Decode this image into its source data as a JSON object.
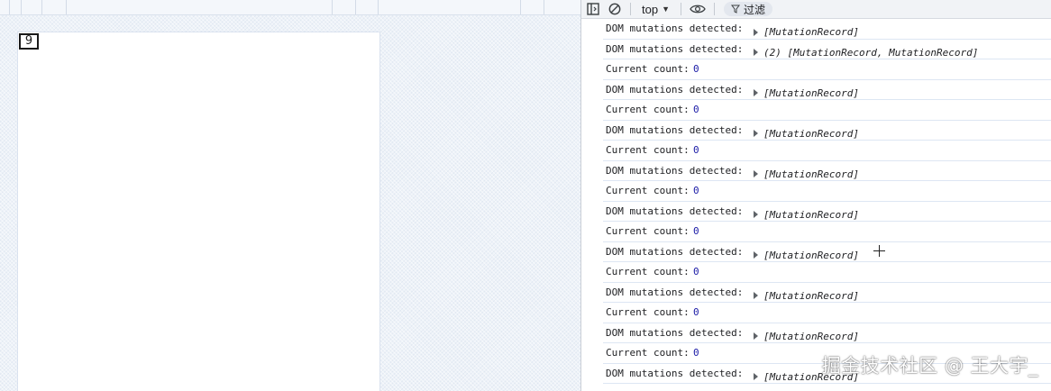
{
  "preview": {
    "counter_value": "9"
  },
  "devtools": {
    "toolbar": {
      "context": "top",
      "filter_label": "过滤"
    },
    "console_rows": [
      {
        "type": "mutation",
        "text": "DOM mutations detected:",
        "obj": "[MutationRecord]"
      },
      {
        "type": "mutation",
        "text": "DOM mutations detected:",
        "obj": "(2) [MutationRecord, MutationRecord]"
      },
      {
        "type": "count",
        "text": "Current count:",
        "value": "0"
      },
      {
        "type": "mutation",
        "text": "DOM mutations detected:",
        "obj": "[MutationRecord]"
      },
      {
        "type": "count",
        "text": "Current count:",
        "value": "0"
      },
      {
        "type": "mutation",
        "text": "DOM mutations detected:",
        "obj": "[MutationRecord]"
      },
      {
        "type": "count",
        "text": "Current count:",
        "value": "0"
      },
      {
        "type": "mutation",
        "text": "DOM mutations detected:",
        "obj": "[MutationRecord]"
      },
      {
        "type": "count",
        "text": "Current count:",
        "value": "0"
      },
      {
        "type": "mutation",
        "text": "DOM mutations detected:",
        "obj": "[MutationRecord]"
      },
      {
        "type": "count",
        "text": "Current count:",
        "value": "0"
      },
      {
        "type": "mutation",
        "text": "DOM mutations detected:",
        "obj": "[MutationRecord]"
      },
      {
        "type": "count",
        "text": "Current count:",
        "value": "0"
      },
      {
        "type": "mutation",
        "text": "DOM mutations detected:",
        "obj": "[MutationRecord]"
      },
      {
        "type": "count",
        "text": "Current count:",
        "value": "0"
      },
      {
        "type": "mutation",
        "text": "DOM mutations detected:",
        "obj": "[MutationRecord]"
      },
      {
        "type": "count",
        "text": "Current count:",
        "value": "0"
      },
      {
        "type": "mutation",
        "text": "DOM mutations detected:",
        "obj": "[MutationRecord]"
      }
    ]
  },
  "watermark": "掘金技术社区 @ 王大宇_",
  "colors": {
    "number": "#1a1aa6",
    "row_border": "#dde6f3",
    "toolbar_bg": "#f1f3f6"
  }
}
